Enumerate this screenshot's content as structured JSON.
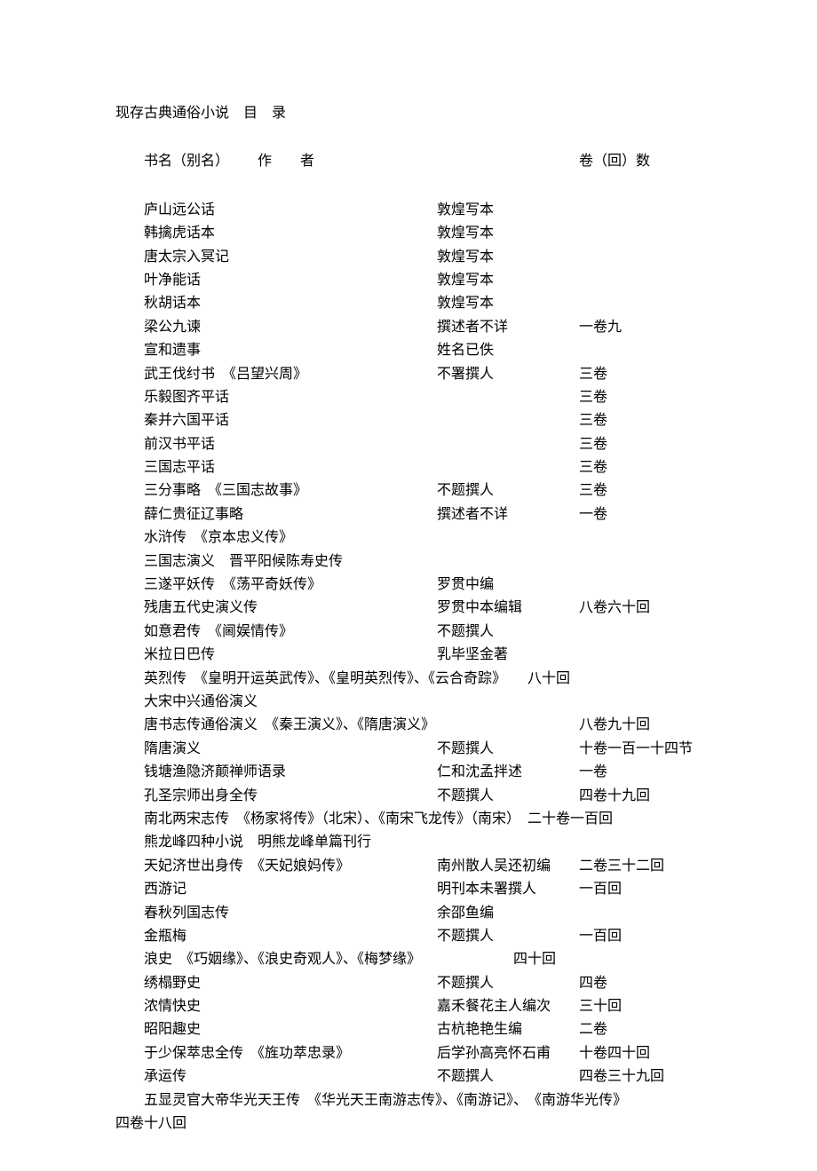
{
  "title_prefix": "现存古典通俗小说",
  "title_suffix": "目　录",
  "header": {
    "col1_a": "书名（别名）",
    "col1_b": "作　　者",
    "col3": "卷（回）数"
  },
  "rows": [
    {
      "type": "std",
      "title": "庐山远公话",
      "author": "敦煌写本",
      "vol": ""
    },
    {
      "type": "std",
      "title": "韩擒虎话本",
      "author": "敦煌写本",
      "vol": ""
    },
    {
      "type": "std",
      "title": "唐太宗入冥记",
      "author": "敦煌写本",
      "vol": ""
    },
    {
      "type": "std",
      "title": "叶净能话",
      "author": "敦煌写本",
      "vol": ""
    },
    {
      "type": "std",
      "title": "秋胡话本",
      "author": "敦煌写本",
      "vol": ""
    },
    {
      "type": "std",
      "title": "梁公九谏",
      "author": "撰述者不详",
      "vol": "一卷九"
    },
    {
      "type": "std",
      "title": "宣和遗事",
      "author": "姓名已佚",
      "vol": ""
    },
    {
      "type": "std",
      "title": "武王伐纣书　《吕望兴周》",
      "author": "不署撰人",
      "vol": "三卷"
    },
    {
      "type": "std",
      "title": "乐毅图齐平话",
      "author": "",
      "vol": "三卷"
    },
    {
      "type": "std",
      "title": "秦并六国平话",
      "author": "",
      "vol": "三卷"
    },
    {
      "type": "std",
      "title": "前汉书平话",
      "author": "",
      "vol": "三卷"
    },
    {
      "type": "std",
      "title": "三国志平话",
      "author": "",
      "vol": "三卷"
    },
    {
      "type": "std",
      "title": "三分事略　《三国志故事》",
      "author": "不题撰人",
      "vol": "三卷"
    },
    {
      "type": "std",
      "title": "薛仁贵征辽事略",
      "author": "撰述者不详",
      "vol": "一卷"
    },
    {
      "type": "std",
      "title": "水浒传　《京本忠义传》",
      "author": "",
      "vol": ""
    },
    {
      "type": "std",
      "title": "三国志演义　晋平阳候陈寿史传",
      "author": "",
      "vol": ""
    },
    {
      "type": "std",
      "title": "三遂平妖传　《荡平奇妖传》",
      "author": "罗贯中编",
      "vol": ""
    },
    {
      "type": "std",
      "title": "残唐五代史演义传",
      "author": "罗贯中本编辑",
      "vol": "八卷六十回"
    },
    {
      "type": "std",
      "title": "如意君传　《阃娱情传》",
      "author": "不题撰人",
      "vol": ""
    },
    {
      "type": "std",
      "title": "米拉日巴传",
      "author": "乳毕坚金著",
      "vol": ""
    },
    {
      "type": "full",
      "text": "英烈传　《皇明开运英武传》、《皇明英烈传》、《云合奇踪》　　八十回"
    },
    {
      "type": "std",
      "title": "大宋中兴通俗演义",
      "author": "",
      "vol": ""
    },
    {
      "type": "std",
      "title": "唐书志传通俗演义　《秦王演义》、《隋唐演义》",
      "author": "",
      "vol": "八卷九十回"
    },
    {
      "type": "std",
      "title": "隋唐演义",
      "author": "不题撰人",
      "vol": "十卷一百一十四节"
    },
    {
      "type": "std",
      "title": "钱塘渔隐济颠禅师语录",
      "author": "仁和沈孟拌述",
      "vol": "一卷"
    },
    {
      "type": "std",
      "title": "孔圣宗师出身全传",
      "author": "不题撰人",
      "vol": "四卷十九回"
    },
    {
      "type": "full",
      "text": "南北两宋志传　《杨家将传》（北宋）、《南宋飞龙传》（南宋）　二十卷一百回"
    },
    {
      "type": "std",
      "title": "熊龙峰四种小说　明熊龙峰单篇刊行",
      "author": "",
      "vol": ""
    },
    {
      "type": "std",
      "title": "天妃济世出身传　《天妃娘妈传》",
      "author": "南州散人吴还初编",
      "vol": "二卷三十二回"
    },
    {
      "type": "std",
      "title": "西游记",
      "author": "明刊本未署撰人",
      "vol": "一百回"
    },
    {
      "type": "std",
      "title": "春秋列国志传",
      "author": "余邵鱼编",
      "vol": ""
    },
    {
      "type": "std",
      "title": "金瓶梅",
      "author": "不题撰人",
      "vol": "一百回"
    },
    {
      "type": "full",
      "text": "浪史　《巧姻缘》、《浪史奇观人》、《梅梦缘》　　　　　　　四十回"
    },
    {
      "type": "std",
      "title": "绣榻野史",
      "author": "不题撰人",
      "vol": "四卷"
    },
    {
      "type": "std",
      "title": "浓情快史",
      "author": "嘉禾餐花主人编次",
      "vol": "三十回"
    },
    {
      "type": "std",
      "title": "昭阳趣史",
      "author": "古杭艳艳生编",
      "vol": "二卷"
    },
    {
      "type": "std",
      "title": "于少保萃忠全传　《旌功萃忠录》",
      "author": "后学孙高亮怀石甫",
      "vol": "十卷四十回"
    },
    {
      "type": "std",
      "title": "承运传",
      "author": "不题撰人",
      "vol": "四卷三十九回"
    },
    {
      "type": "full",
      "text": "五显灵官大帝华光天王传　《华光天王南游志传》、《南游记》、　《南游华光传》"
    }
  ],
  "trailing": "四卷十八回"
}
